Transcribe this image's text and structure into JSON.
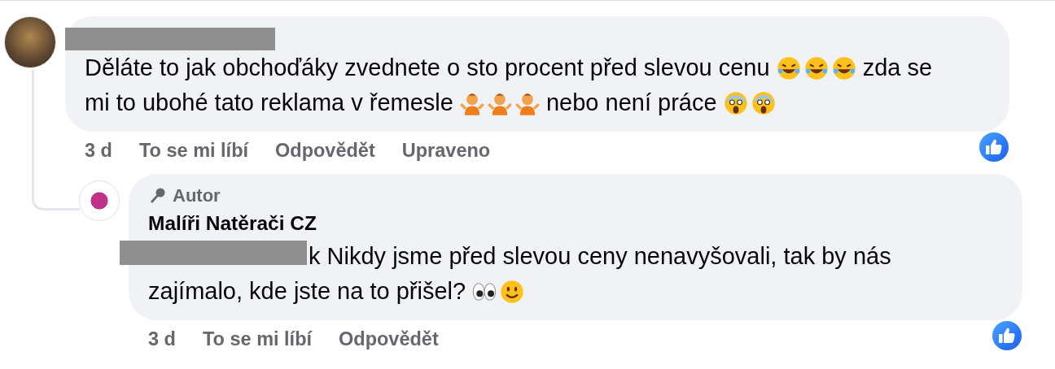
{
  "comments": [
    {
      "redacted_name": true,
      "lines": [
        [
          {
            "kind": "text",
            "text": "Děláte to jak obchoďáky zvednete o sto procent před slevou cenu"
          },
          {
            "kind": "laugh"
          },
          {
            "kind": "laugh"
          },
          {
            "kind": "laugh"
          },
          {
            "kind": "text",
            "text": "zda se"
          }
        ],
        [
          {
            "kind": "text",
            "text": "mi to ubohé tato reklama v řemesle"
          },
          {
            "kind": "shrug"
          },
          {
            "kind": "shrug"
          },
          {
            "kind": "shrug"
          },
          {
            "kind": "text",
            "text": "nebo není práce"
          },
          {
            "kind": "scream"
          },
          {
            "kind": "scream"
          }
        ]
      ],
      "actions": [
        "3 d",
        "To se mi líbí",
        "Odpovědět",
        "Upraveno"
      ],
      "replies": [
        {
          "author_badge": "Autor",
          "author": "Malíři Natěrači CZ",
          "redacted_mention": true,
          "lines": [
            [
              {
                "kind": "text",
                "text": "k Nikdy jsme před slevou ceny nenavyšovali, tak by nás"
              }
            ],
            [
              {
                "kind": "text",
                "text": "zajímalo, kde jste na to přišel?"
              },
              {
                "kind": "eyes"
              },
              {
                "kind": "smile"
              }
            ]
          ],
          "actions": [
            "3 d",
            "To se mi líbí",
            "Odpovědět"
          ]
        }
      ]
    }
  ]
}
